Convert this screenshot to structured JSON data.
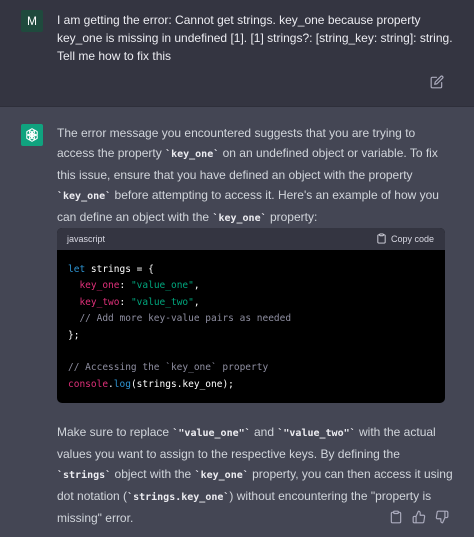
{
  "user_message": {
    "avatar_letter": "M",
    "text": "I am getting the error: Cannot get strings. key_one because property key_one is missing in undefined [1]. [1] strings?: [string_key: string]: string. Tell me how to fix this"
  },
  "assistant_message": {
    "intro": {
      "t1": "The error message you encountered suggests that you are trying to access the property ",
      "c1": "`key_one`",
      "t2": " on an undefined object or variable. To fix this issue, ensure that you have defined an object with the property ",
      "c2": "`key_one`",
      "t3": " before attempting to access it. Here's an example of how you can define an object with the ",
      "c3": "`key_one`",
      "t4": " property:"
    },
    "code_block": {
      "language": "javascript",
      "copy_label": "Copy code",
      "lines": {
        "l1_kw": "let",
        "l1_rest": " strings = {",
        "l2_key": "key_one",
        "l2_colon": ": ",
        "l2_val": "\"value_one\"",
        "l2_end": ",",
        "l3_key": "key_two",
        "l3_colon": ": ",
        "l3_val": "\"value_two\"",
        "l3_end": ",",
        "l4_comment": "// Add more key-value pairs as needed",
        "l5": "};",
        "l7_comment": "// Accessing the `key_one` property",
        "l8_obj": "console",
        "l8_dot": ".",
        "l8_fn": "log",
        "l8_rest": "(strings.key_one);"
      }
    },
    "outro": {
      "t1": "Make sure to replace ",
      "c1": "`\"value_one\"`",
      "t2": " and ",
      "c2": "`\"value_two\"`",
      "t3": " with the actual values you want to assign to the respective keys. By defining the ",
      "c3": "`strings`",
      "t4": " object with the ",
      "c4": "`key_one`",
      "t5": " property, you can then access it using dot notation (",
      "c5": "`strings.key_one`",
      "t6": ") without encountering the \"property is missing\" error."
    }
  },
  "icons": {
    "edit": "edit-icon",
    "copy": "clipboard-icon",
    "thumbs_up": "thumbs-up-icon",
    "thumbs_down": "thumbs-down-icon",
    "brand_color": "#10a37f"
  }
}
